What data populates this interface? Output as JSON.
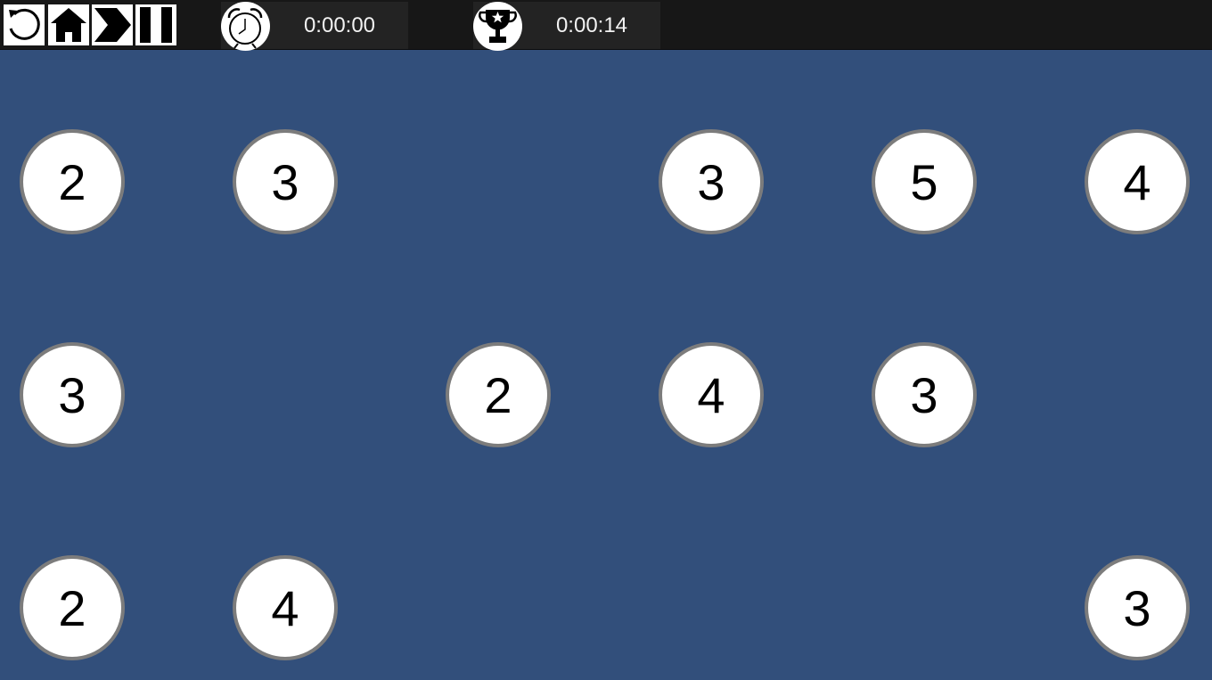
{
  "toolbar": {
    "buttons": [
      {
        "icon": "undo-icon"
      },
      {
        "icon": "home-icon"
      },
      {
        "icon": "next-icon"
      },
      {
        "icon": "pause-icon"
      }
    ]
  },
  "timers": {
    "current": {
      "icon": "alarm-clock-icon",
      "value": "0:00:00"
    },
    "best": {
      "icon": "trophy-icon",
      "value": "0:00:14"
    }
  },
  "colors": {
    "board_background": "#324f7b",
    "topbar_background": "#171717",
    "island_fill": "#ffffff",
    "island_border": "#7c7c7c"
  },
  "board": {
    "islands": [
      {
        "row": 0,
        "col": 0,
        "value": "2"
      },
      {
        "row": 0,
        "col": 1,
        "value": "3"
      },
      {
        "row": 0,
        "col": 3,
        "value": "3"
      },
      {
        "row": 0,
        "col": 4,
        "value": "5"
      },
      {
        "row": 0,
        "col": 5,
        "value": "4"
      },
      {
        "row": 1,
        "col": 0,
        "value": "3"
      },
      {
        "row": 1,
        "col": 2,
        "value": "2"
      },
      {
        "row": 1,
        "col": 3,
        "value": "4"
      },
      {
        "row": 1,
        "col": 4,
        "value": "3"
      },
      {
        "row": 2,
        "col": 0,
        "value": "2"
      },
      {
        "row": 2,
        "col": 1,
        "value": "4"
      },
      {
        "row": 2,
        "col": 5,
        "value": "3"
      }
    ]
  }
}
